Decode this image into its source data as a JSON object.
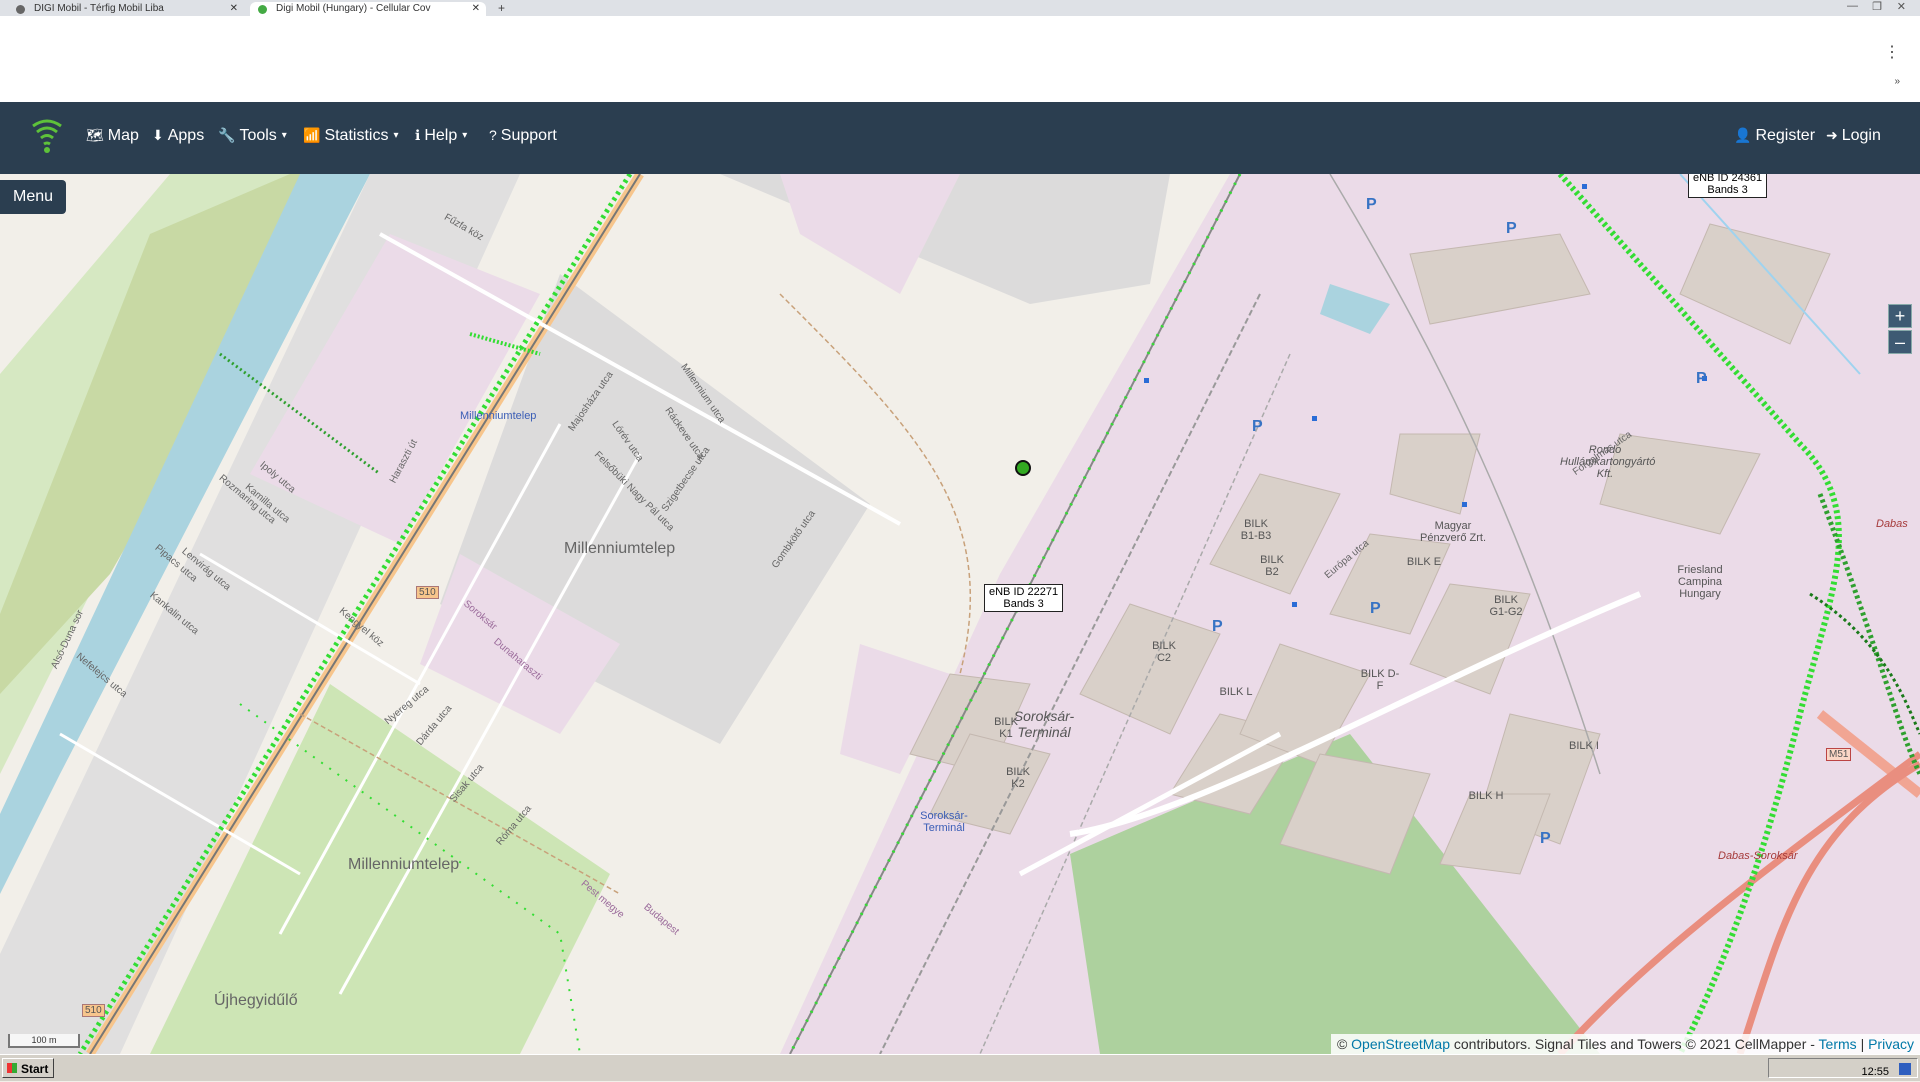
{
  "browser": {
    "tabs": [
      {
        "title": "DIGI Mobil - Térfig Mobil Liba"
      },
      {
        "title": "Digi Mobil (Hungary) - Cellular Cov"
      }
    ],
    "new_tab": "+",
    "window_controls": [
      "—",
      "❐",
      "✕"
    ],
    "menu_icon": "⋮",
    "extension_icon": "»"
  },
  "navbar": {
    "items": [
      {
        "label": "Map",
        "icon": "🗺"
      },
      {
        "label": "Apps",
        "icon": "⬇"
      },
      {
        "label": "Tools",
        "icon": "🔧"
      },
      {
        "label": "Statistics",
        "icon": "📶"
      },
      {
        "label": "Help",
        "icon": "ℹ"
      },
      {
        "label": "Support",
        "icon": "?"
      }
    ],
    "right": [
      {
        "label": "Register",
        "icon": "👤"
      },
      {
        "label": "Login",
        "icon": "➜"
      }
    ],
    "caret": "▾"
  },
  "map": {
    "menu_button": "Menu",
    "zoom_in": "+",
    "zoom_out": "–",
    "towers": [
      {
        "id_text": "eNB ID 22271",
        "bands_text": "Bands 3"
      },
      {
        "id_text": "eNB ID 24361",
        "bands_text": "Bands 3"
      }
    ],
    "labels": {
      "millenniumtelep_station": "Millenniumtelep",
      "millenniumtelep_north": "Millenniumtelep",
      "millenniumtelep_south": "Millenniumtelep",
      "ujhegyidulo": "Újhegyidűlő",
      "soroksar_terminal": "Soroksár-Terminál",
      "soroksar_terminal_stop": "Soroksár-Terminál",
      "rondo": "Rondo Hullámkartongyártó Kft.",
      "magyar_penzvero": "Magyar Pénzverő Zrt.",
      "friesland": "Friesland Campina Hungary",
      "dabas_soroksar": "Dabas-Soroksár",
      "m51": "M51",
      "road_510_a": "510",
      "road_510_b": "510",
      "dabas": "Dabas",
      "budapest": "Budapest",
      "pest_megye": "Pest megye",
      "soroksar": "Soroksár",
      "dunaharaszti": "Dunaharaszti"
    },
    "buildings": [
      "BILK B1-B3",
      "BILK B2",
      "BILK E",
      "BILK G1-G2",
      "BILK C2",
      "BILK D-F",
      "BILK L",
      "BILK K1",
      "BILK K2",
      "BILK I",
      "BILK H"
    ],
    "streets": {
      "fuzfa": "Fűzfa köz",
      "millennium": "Millennium utca",
      "rackeve": "Ráckeve utca",
      "majosha": "Majosháza utca",
      "lorev": "Lórév utca",
      "szigetbecse": "Szigetbecse utca",
      "felsobuki": "Felsőbüki Nagy Pál utca",
      "ipoly": "Ipoly utca",
      "kamilla": "Kamilla utca",
      "rozmaring": "Rozmaring utca",
      "lenvirag": "Lenvirág utca",
      "pipacs": "Pipacs utca",
      "kankalin": "Kankalin utca",
      "nefelejcs": "Nefelejcs utca",
      "haraszti": "Haraszti út",
      "gombkoto": "Gombkötő utca",
      "europa": "Európa utca",
      "forgalmas": "Forgalmas utca",
      "kengyel": "Kengyel köz",
      "nyereg": "Nyereg utca",
      "darda": "Dárda utca",
      "sisak": "Sisak utca",
      "roma": "Róma utca",
      "duna_sor": "Alsó-Duna sor"
    },
    "scale": "100 m",
    "attribution": {
      "prefix": "©",
      "osm": "OpenStreetMap",
      "text": "contributors. Signal Tiles and Towers © 2021 CellMapper -",
      "terms": "Terms",
      "sep": "|",
      "privacy": "Privacy"
    },
    "colors": {
      "signal": "#33dd33",
      "road_main": "#f7c58c",
      "industrial": "#ebdbe8",
      "water": "#aad3df",
      "park": "#cde5b5"
    }
  },
  "taskbar": {
    "start": "Start",
    "clock": "12:55"
  }
}
